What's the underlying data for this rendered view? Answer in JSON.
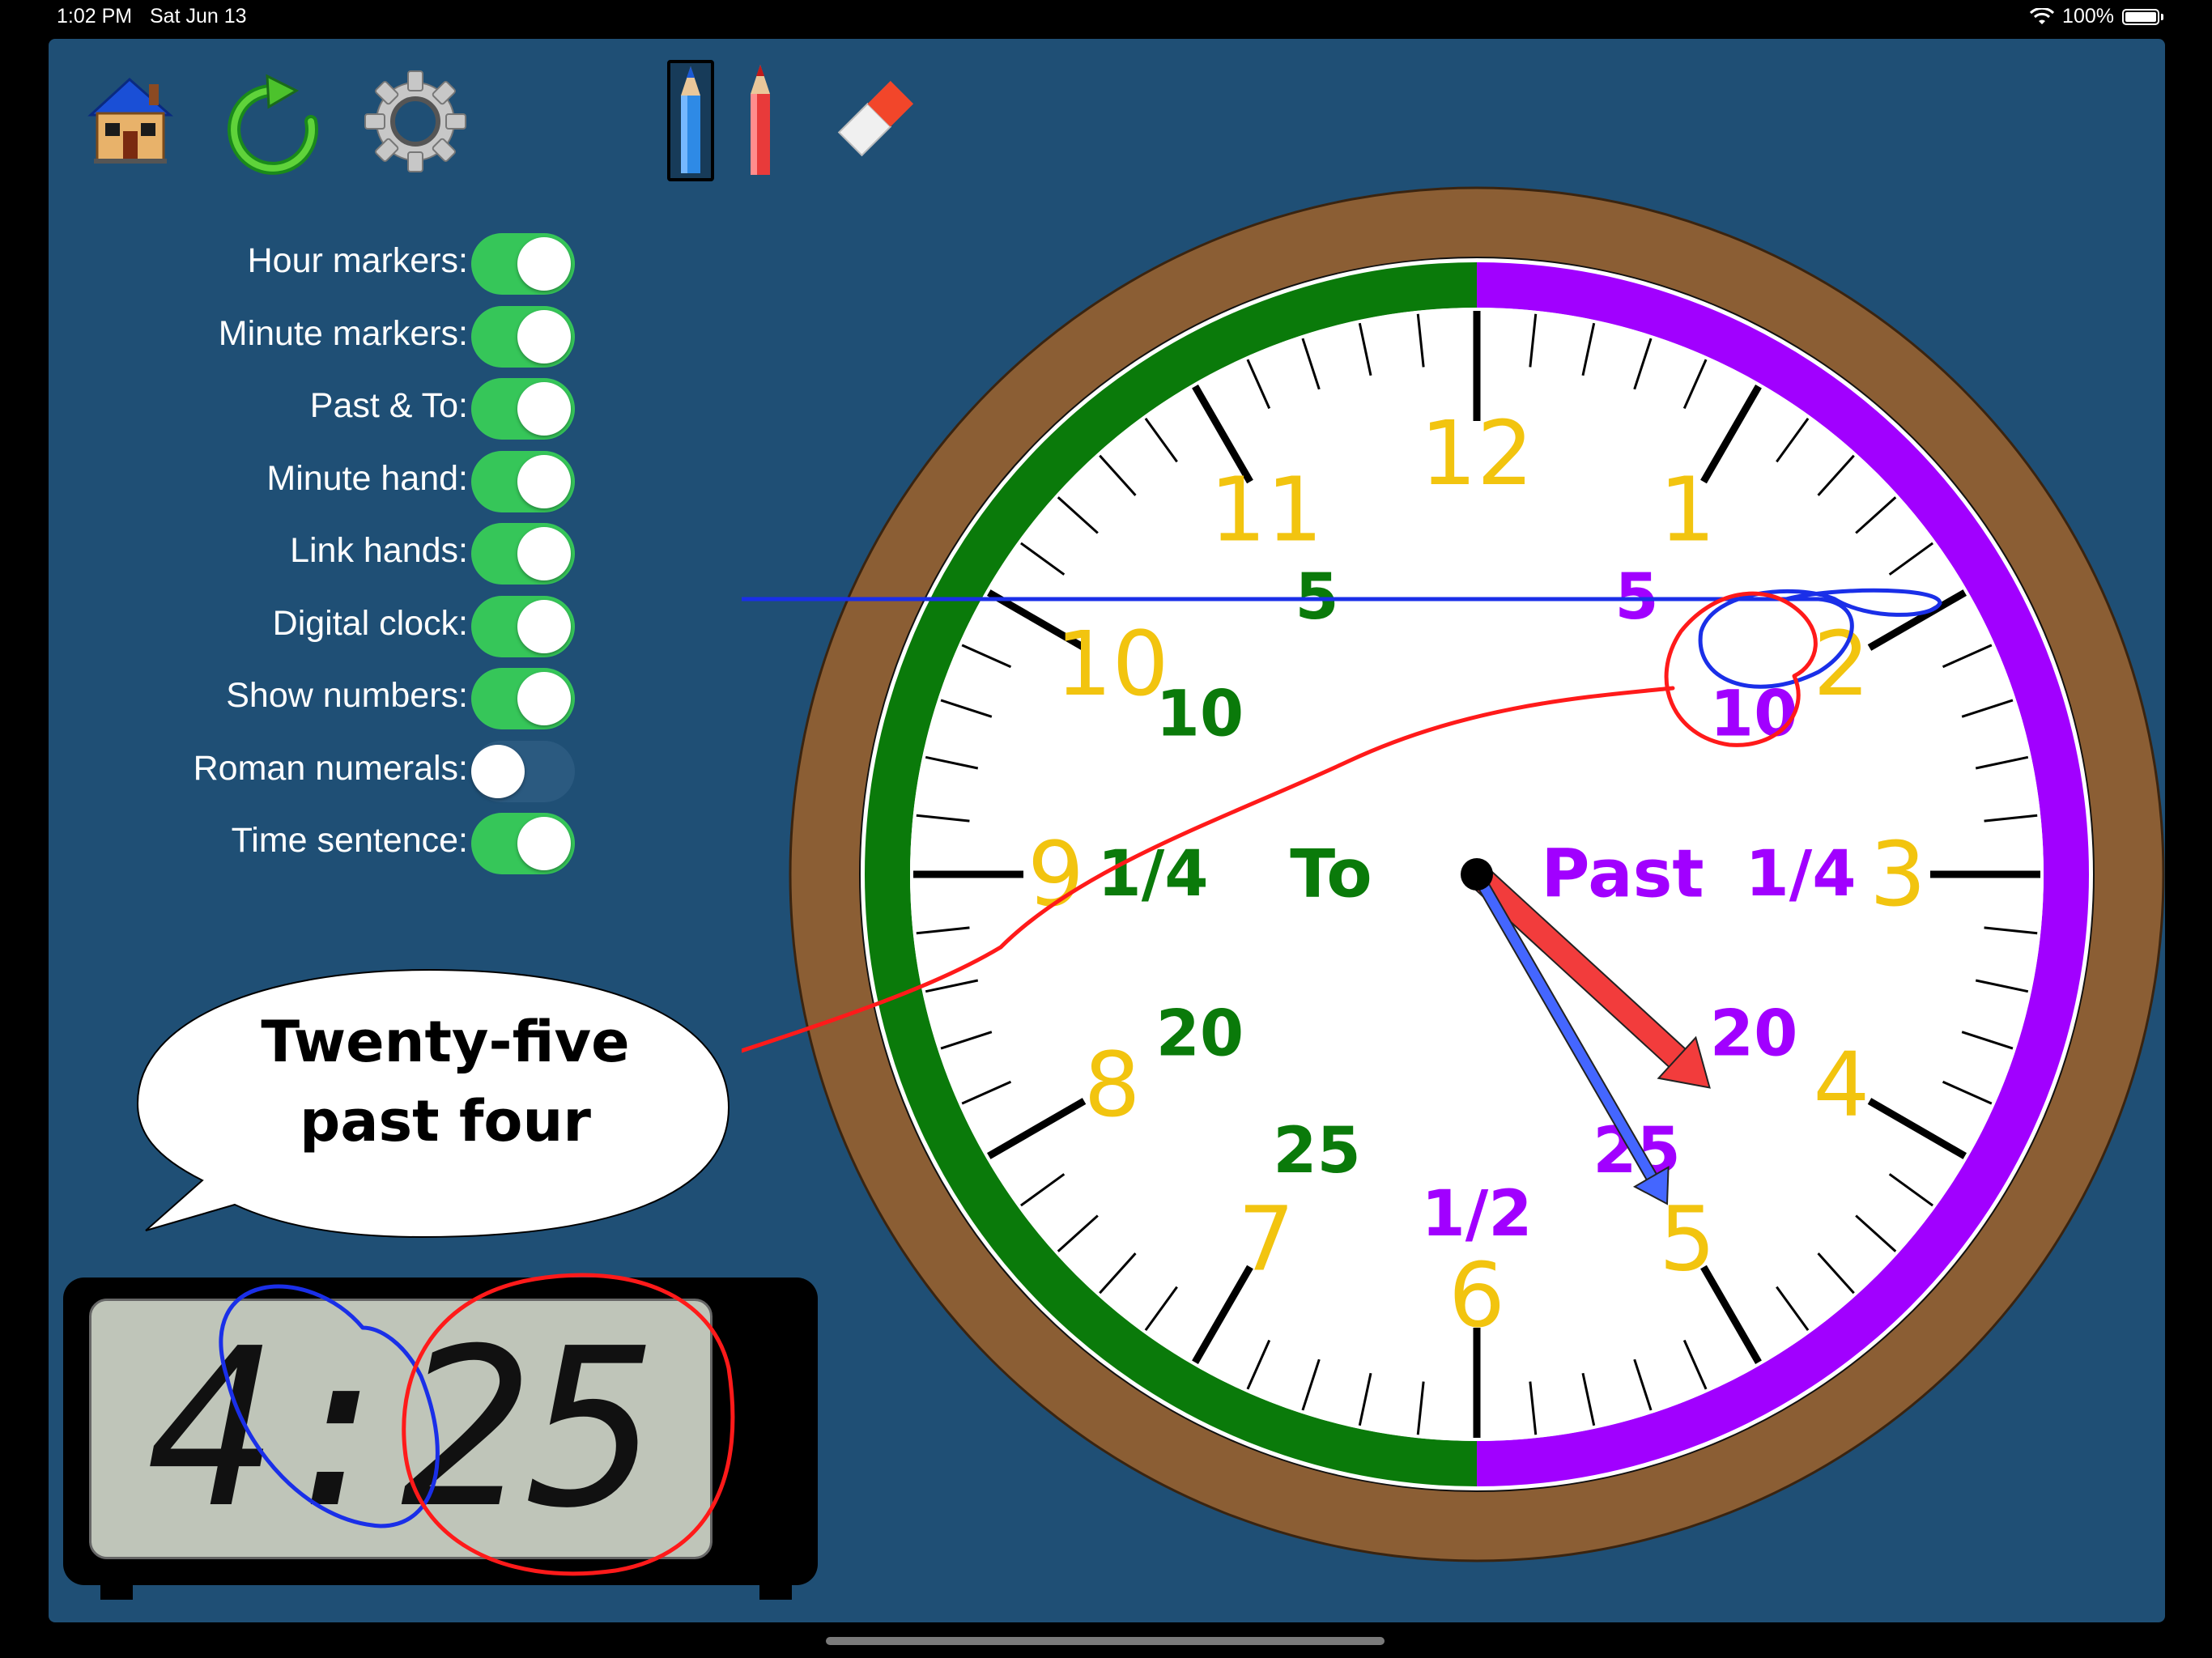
{
  "status_bar": {
    "time": "1:02 PM",
    "date": "Sat Jun 13",
    "battery": "100%"
  },
  "toolbar": {
    "home": "house-icon",
    "reset": "refresh-icon",
    "settings": "gear-icon",
    "blue_pencil": "blue-pencil-icon",
    "red_pencil": "red-pencil-icon",
    "eraser": "eraser-icon",
    "selected_tool": "blue_pencil"
  },
  "settings": [
    {
      "label": "Hour markers:",
      "on": true
    },
    {
      "label": "Minute markers:",
      "on": true
    },
    {
      "label": "Past & To:",
      "on": true
    },
    {
      "label": "Minute hand:",
      "on": true
    },
    {
      "label": "Link hands:",
      "on": true
    },
    {
      "label": "Digital clock:",
      "on": true
    },
    {
      "label": "Show numbers:",
      "on": true
    },
    {
      "label": "Roman numerals:",
      "on": false
    },
    {
      "label": "Time sentence:",
      "on": true
    }
  ],
  "time_sentence": {
    "line1": "Twenty-five",
    "line2": "past four"
  },
  "digital_clock": {
    "time": "4:25"
  },
  "clock": {
    "time": {
      "hours": 4,
      "minutes": 25
    },
    "hour_numbers": [
      "12",
      "1",
      "2",
      "3",
      "4",
      "5",
      "6",
      "7",
      "8",
      "9",
      "10",
      "11"
    ],
    "past_label": "Past",
    "to_label": "To",
    "past_minutes": [
      "5",
      "10",
      "1/4",
      "20",
      "25",
      "1/2"
    ],
    "to_minutes": [
      "5",
      "10",
      "1/4",
      "20",
      "25"
    ],
    "colors": {
      "past": "#a100ff",
      "to": "#0a7a0a",
      "hour_numbers": "#f2c40f",
      "frame": "#8b5e34",
      "hour_hand": "#f23c3c",
      "minute_hand": "#4466ff"
    }
  }
}
